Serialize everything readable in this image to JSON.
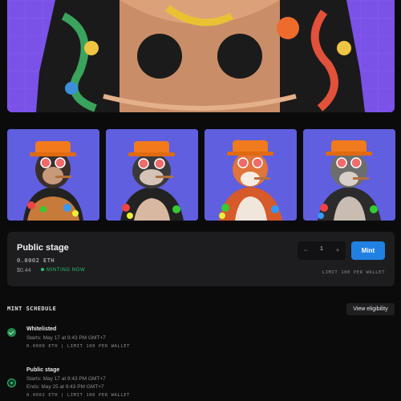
{
  "colors": {
    "background": "#0b0b0c",
    "panel": "#1d1d20",
    "accent_blue": "#2081e2",
    "live_green": "#2fbf71",
    "hero_purple": "#7a52e8",
    "thumb_blue": "#5f5fe0"
  },
  "hero": {
    "image": "tattooed-ape-hero"
  },
  "gallery": [
    {
      "image": "monkey-bucket-hat"
    },
    {
      "image": "bulldog-bucket-hat"
    },
    {
      "image": "shiba-bucket-hat"
    },
    {
      "image": "wolf-bucket-hat"
    }
  ],
  "mint": {
    "stage_title": "Public stage",
    "price_eth": "0.0002 ETH",
    "price_usd": "$0.44",
    "status": "MINTING NOW",
    "quantity": "1",
    "minus_icon": "minus-icon",
    "plus_icon": "plus-icon",
    "mint_label": "Mint",
    "limit_text": "LIMIT 100 PER WALLET"
  },
  "schedule": {
    "title": "MINT SCHEDULE",
    "eligibility_label": "View eligibility",
    "items": [
      {
        "name": "Whitelisted",
        "starts": "Starts: May 17 at 9:43 PM GMT+7",
        "details": "0.0000 ETH | LIMIT 100 PER WALLET",
        "icon": "check-circle-icon"
      },
      {
        "name": "Public stage",
        "starts": "Starts: May 17 at 9:43 PM GMT+7",
        "ends": "Ends: May 25 at 9:43 PM GMT+7",
        "details": "0.0002 ETH | LIMIT 100 PER WALLET",
        "icon": "live-dot-icon"
      }
    ]
  }
}
